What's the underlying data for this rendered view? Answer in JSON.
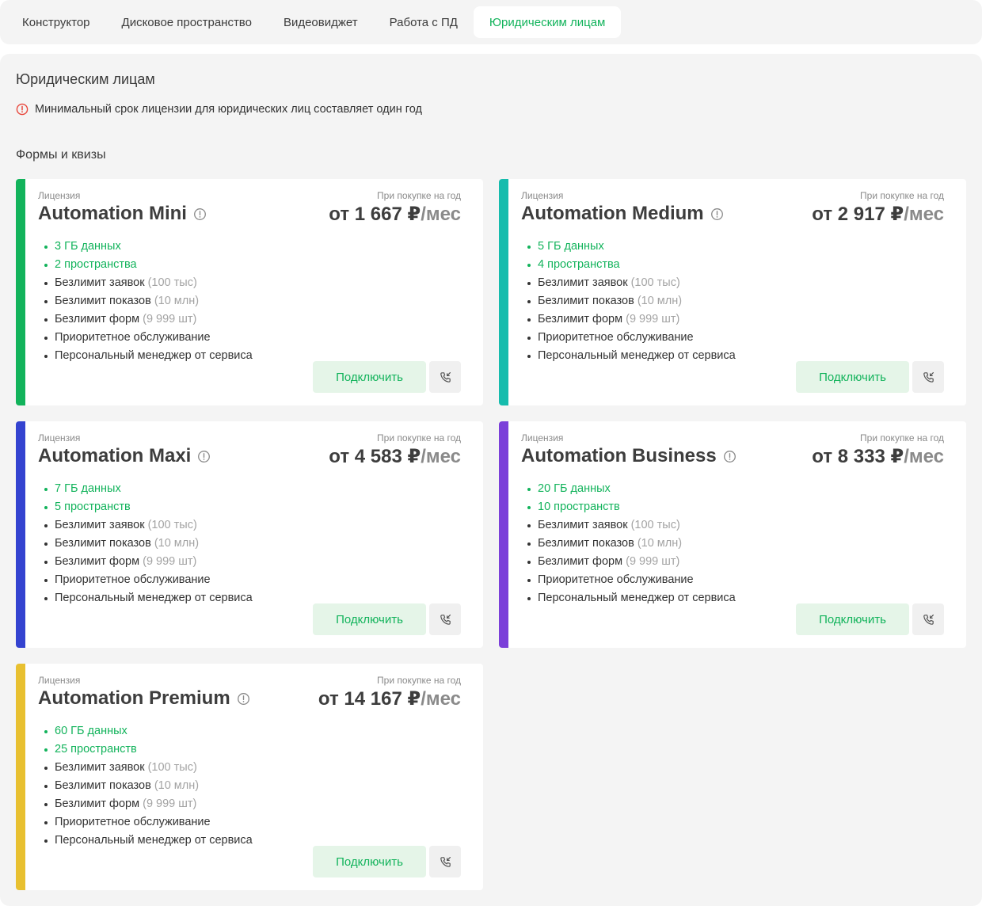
{
  "tabs": [
    {
      "label": "Конструктор"
    },
    {
      "label": "Дисковое пространство"
    },
    {
      "label": "Видеовиджет"
    },
    {
      "label": "Работа с ПД"
    },
    {
      "label": "Юридическим лицам"
    }
  ],
  "active_tab_index": 4,
  "page": {
    "title": "Юридическим лицам",
    "notice": "Минимальный срок лицензии для юридических лиц составляет один год",
    "section_title": "Формы и квизы"
  },
  "colors": {
    "accent": "#12b35b",
    "warning": "#e8473c"
  },
  "plans": [
    {
      "strip_color": "#12b35b",
      "license_label": "Лицензия",
      "name": "Automation Mini",
      "year_label": "При покупке на год",
      "price": "от 1 667 ₽",
      "price_unit": "/мес",
      "features": [
        {
          "text": "3 ГБ данных",
          "note": ""
        },
        {
          "text": "2 пространства",
          "note": ""
        },
        {
          "text": "Безлимит заявок",
          "note": "(100 тыс)"
        },
        {
          "text": "Безлимит показов",
          "note": "(10 млн)"
        },
        {
          "text": "Безлимит форм",
          "note": "(9 999 шт)"
        },
        {
          "text": "Приоритетное обслуживание",
          "note": ""
        },
        {
          "text": "Персональный менеджер от сервиса",
          "note": ""
        }
      ],
      "connect_label": "Подключить",
      "call_icon": "phone-callback-icon"
    },
    {
      "strip_color": "#16bcad",
      "license_label": "Лицензия",
      "name": "Automation Medium",
      "year_label": "При покупке на год",
      "price": "от 2 917 ₽",
      "price_unit": "/мес",
      "features": [
        {
          "text": "5 ГБ данных",
          "note": ""
        },
        {
          "text": "4 пространства",
          "note": ""
        },
        {
          "text": "Безлимит заявок",
          "note": "(100 тыс)"
        },
        {
          "text": "Безлимит показов",
          "note": "(10 млн)"
        },
        {
          "text": "Безлимит форм",
          "note": "(9 999 шт)"
        },
        {
          "text": "Приоритетное обслуживание",
          "note": ""
        },
        {
          "text": "Персональный менеджер от сервиса",
          "note": ""
        }
      ],
      "connect_label": "Подключить",
      "call_icon": "phone-callback-icon"
    },
    {
      "strip_color": "#3443d0",
      "license_label": "Лицензия",
      "name": "Automation Maxi",
      "year_label": "При покупке на год",
      "price": "от 4 583 ₽",
      "price_unit": "/мес",
      "features": [
        {
          "text": "7 ГБ данных",
          "note": ""
        },
        {
          "text": "5 пространств",
          "note": ""
        },
        {
          "text": "Безлимит заявок",
          "note": "(100 тыс)"
        },
        {
          "text": "Безлимит показов",
          "note": "(10 млн)"
        },
        {
          "text": "Безлимит форм",
          "note": "(9 999 шт)"
        },
        {
          "text": "Приоритетное обслуживание",
          "note": ""
        },
        {
          "text": "Персональный менеджер от сервиса",
          "note": ""
        }
      ],
      "connect_label": "Подключить",
      "call_icon": "phone-callback-icon"
    },
    {
      "strip_color": "#7b3fd9",
      "license_label": "Лицензия",
      "name": "Automation Business",
      "year_label": "При покупке на год",
      "price": "от 8 333 ₽",
      "price_unit": "/мес",
      "features": [
        {
          "text": "20 ГБ данных",
          "note": ""
        },
        {
          "text": "10 пространств",
          "note": ""
        },
        {
          "text": "Безлимит заявок",
          "note": "(100 тыс)"
        },
        {
          "text": "Безлимит показов",
          "note": "(10 млн)"
        },
        {
          "text": "Безлимит форм",
          "note": "(9 999 шт)"
        },
        {
          "text": "Приоритетное обслуживание",
          "note": ""
        },
        {
          "text": "Персональный менеджер от сервиса",
          "note": ""
        }
      ],
      "connect_label": "Подключить",
      "call_icon": "phone-callback-icon"
    },
    {
      "strip_color": "#e8c030",
      "license_label": "Лицензия",
      "name": "Automation Premium",
      "year_label": "При покупке на год",
      "price": "от 14 167 ₽",
      "price_unit": "/мес",
      "features": [
        {
          "text": "60 ГБ данных",
          "note": ""
        },
        {
          "text": "25 пространств",
          "note": ""
        },
        {
          "text": "Безлимит заявок",
          "note": "(100 тыс)"
        },
        {
          "text": "Безлимит показов",
          "note": "(10 млн)"
        },
        {
          "text": "Безлимит форм",
          "note": "(9 999 шт)"
        },
        {
          "text": "Приоритетное обслуживание",
          "note": ""
        },
        {
          "text": "Персональный менеджер от сервиса",
          "note": ""
        }
      ],
      "connect_label": "Подключить",
      "call_icon": "phone-callback-icon"
    }
  ]
}
